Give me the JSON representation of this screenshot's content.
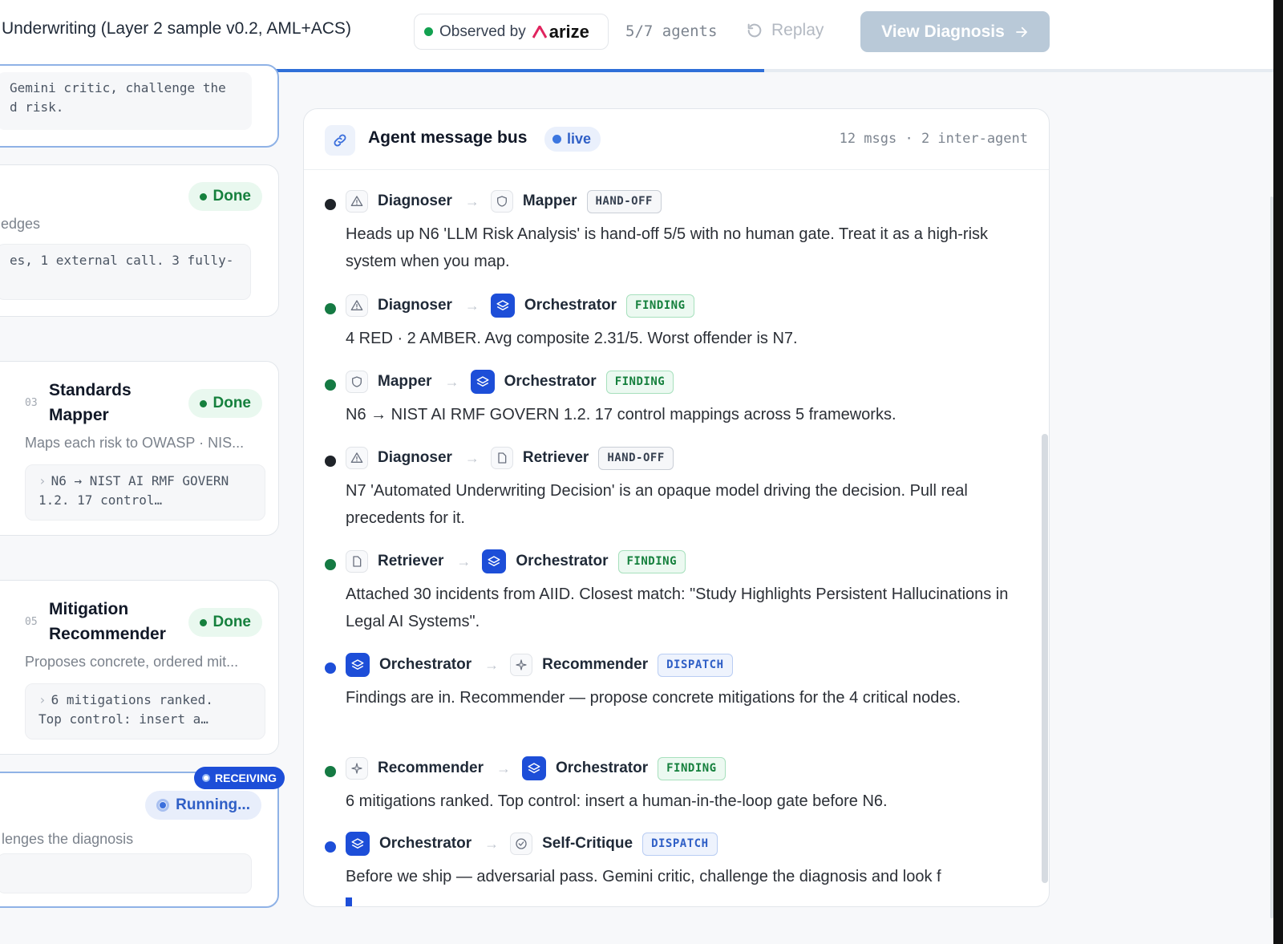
{
  "header": {
    "title": "Underwriting (Layer 2 sample v0.2, AML+ACS)",
    "observed_label": "Observed by",
    "observer_brand": "arize",
    "agents_count": "5/7 agents",
    "replay_label": "Replay",
    "view_button": "View Diagnosis",
    "progress_fraction": 0.6
  },
  "left_cards": [
    {
      "box_text": "Gemini critic, challenge the\nd risk."
    },
    {
      "status": "Done",
      "subtitle": "edges",
      "box_text": "es, 1 external call. 3 fully-"
    },
    {
      "num": "03",
      "title": "Standards\nMapper",
      "status": "Done",
      "subtitle": "Maps each risk to OWASP · NIS...",
      "box_text": "N6 → NIST AI RMF GOVERN\n1.2. 17 control…"
    },
    {
      "num": "05",
      "title": "Mitigation\nRecommender",
      "status": "Done",
      "subtitle": "Proposes concrete, ordered mit...",
      "box_text": "6 mitigations ranked.\nTop control: insert a…"
    },
    {
      "badge": "RECEIVING",
      "status": "Running...",
      "subtitle": "lenges the diagnosis"
    }
  ],
  "bus": {
    "title": "Agent message bus",
    "live_label": "live",
    "meta": "12 msgs · 2 inter-agent",
    "messages": [
      {
        "from": "Diagnoser",
        "from_icon": "warning-icon",
        "to": "Mapper",
        "to_icon": "shield-icon",
        "tag": "HAND-OFF",
        "tag_kind": "handoff",
        "bullet_color": "#1f2329",
        "text": "Heads up N6 'LLM Risk Analysis' is hand-off 5/5 with no human gate. Treat it as a high-risk system when you map."
      },
      {
        "from": "Diagnoser",
        "from_icon": "warning-icon",
        "to": "Orchestrator",
        "to_icon": "layers-icon",
        "tag": "FINDING",
        "tag_kind": "finding",
        "bullet_color": "#157a43",
        "text": "4 RED · 2 AMBER. Avg composite 2.31/5. Worst offender is N7."
      },
      {
        "from": "Mapper",
        "from_icon": "shield-icon",
        "to": "Orchestrator",
        "to_icon": "layers-icon",
        "tag": "FINDING",
        "tag_kind": "finding",
        "bullet_color": "#157a43",
        "text": "N6 → NIST AI RMF GOVERN 1.2. 17 control mappings across 5 frameworks."
      },
      {
        "from": "Diagnoser",
        "from_icon": "warning-icon",
        "to": "Retriever",
        "to_icon": "file-icon",
        "tag": "HAND-OFF",
        "tag_kind": "handoff",
        "bullet_color": "#1f2329",
        "text": "N7 'Automated Underwriting Decision' is an opaque model driving the decision. Pull real precedents for it."
      },
      {
        "from": "Retriever",
        "from_icon": "file-icon",
        "to": "Orchestrator",
        "to_icon": "layers-icon",
        "tag": "FINDING",
        "tag_kind": "finding",
        "bullet_color": "#157a43",
        "text": "Attached 30 incidents from AIID. Closest match: \"Study Highlights Persistent Hallucinations in Legal AI Systems\"."
      },
      {
        "from": "Orchestrator",
        "from_icon": "layers-icon",
        "to": "Recommender",
        "to_icon": "sparkle-icon",
        "tag": "DISPATCH",
        "tag_kind": "dispatch",
        "bullet_color": "#1d4ed8",
        "text": "Findings are in. Recommender — propose concrete mitigations for the 4 critical nodes."
      },
      {
        "from": "Recommender",
        "from_icon": "sparkle-icon",
        "to": "Orchestrator",
        "to_icon": "layers-icon",
        "tag": "FINDING",
        "tag_kind": "finding",
        "bullet_color": "#157a43",
        "text": "6 mitigations ranked. Top control: insert a human-in-the-loop gate before N6."
      },
      {
        "from": "Orchestrator",
        "from_icon": "layers-icon",
        "to": "Self-Critique",
        "to_icon": "check-circle-icon",
        "tag": "DISPATCH",
        "tag_kind": "dispatch",
        "bullet_color": "#1d4ed8",
        "text": "Before we ship — adversarial pass. Gemini critic, challenge the diagnosis and look f"
      }
    ]
  },
  "colors": {
    "accent": "#1d4ed8",
    "done_green": "#15803d",
    "view_button_disabled": "#b9c9d8"
  }
}
